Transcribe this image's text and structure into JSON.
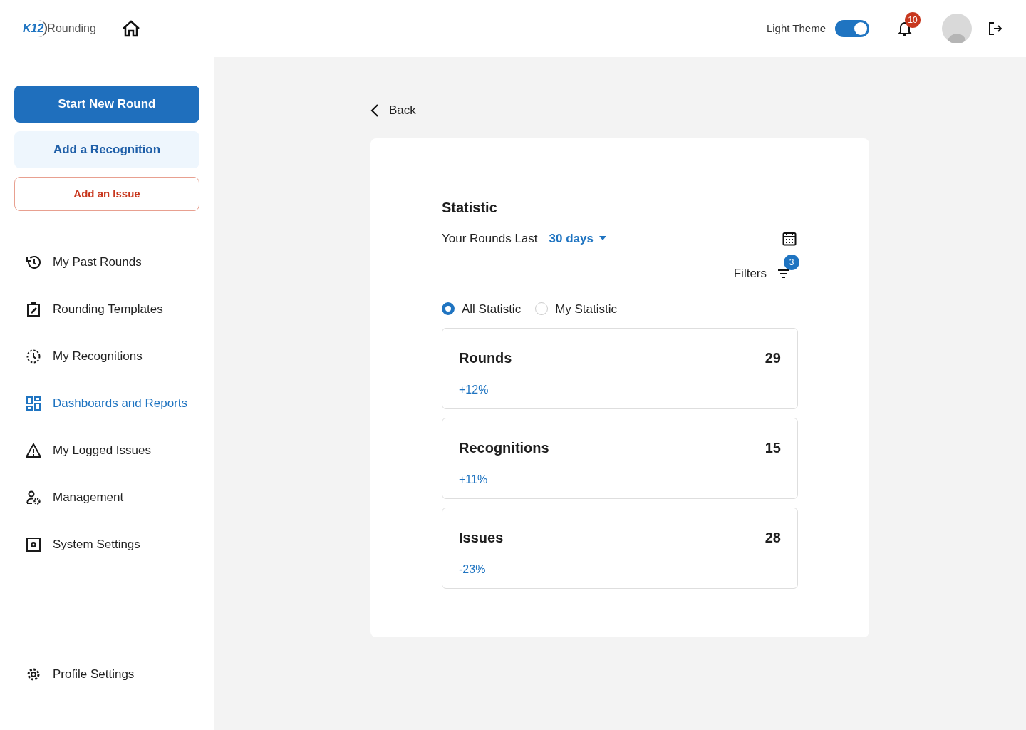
{
  "header": {
    "logo_mark": "K12",
    "logo_text": "Rounding",
    "theme_label": "Light Theme",
    "theme_on": true,
    "notification_count": "10"
  },
  "sidebar": {
    "actions": [
      {
        "label": "Start New Round",
        "kind": "primary"
      },
      {
        "label": "Add a Recognition",
        "kind": "secondary"
      },
      {
        "label": "Add an Issue",
        "kind": "danger"
      }
    ],
    "items": [
      {
        "label": "My Past Rounds",
        "selected": false
      },
      {
        "label": "Rounding Templates",
        "selected": false
      },
      {
        "label": "My Recognitions",
        "selected": false
      },
      {
        "label": "Dashboards and Reports",
        "selected": true
      },
      {
        "label": "My Logged Issues",
        "selected": false
      },
      {
        "label": "Management",
        "selected": false
      },
      {
        "label": "System Settings",
        "selected": false
      }
    ],
    "footer_item": {
      "label": "Profile Settings"
    }
  },
  "main": {
    "back": "Back",
    "title": "Statistic",
    "period_label": "Your Rounds Last",
    "period_value": "30 days",
    "filters_label": "Filters",
    "filters_count": "3",
    "scope": [
      {
        "label": "All Statistic",
        "selected": true
      },
      {
        "label": "My Statistic",
        "selected": false
      }
    ],
    "stats": [
      {
        "title": "Rounds",
        "value": "29",
        "change": "+12%"
      },
      {
        "title": "Recognitions",
        "value": "15",
        "change": "+11%"
      },
      {
        "title": "Issues",
        "value": "28",
        "change": "-23%"
      }
    ]
  }
}
